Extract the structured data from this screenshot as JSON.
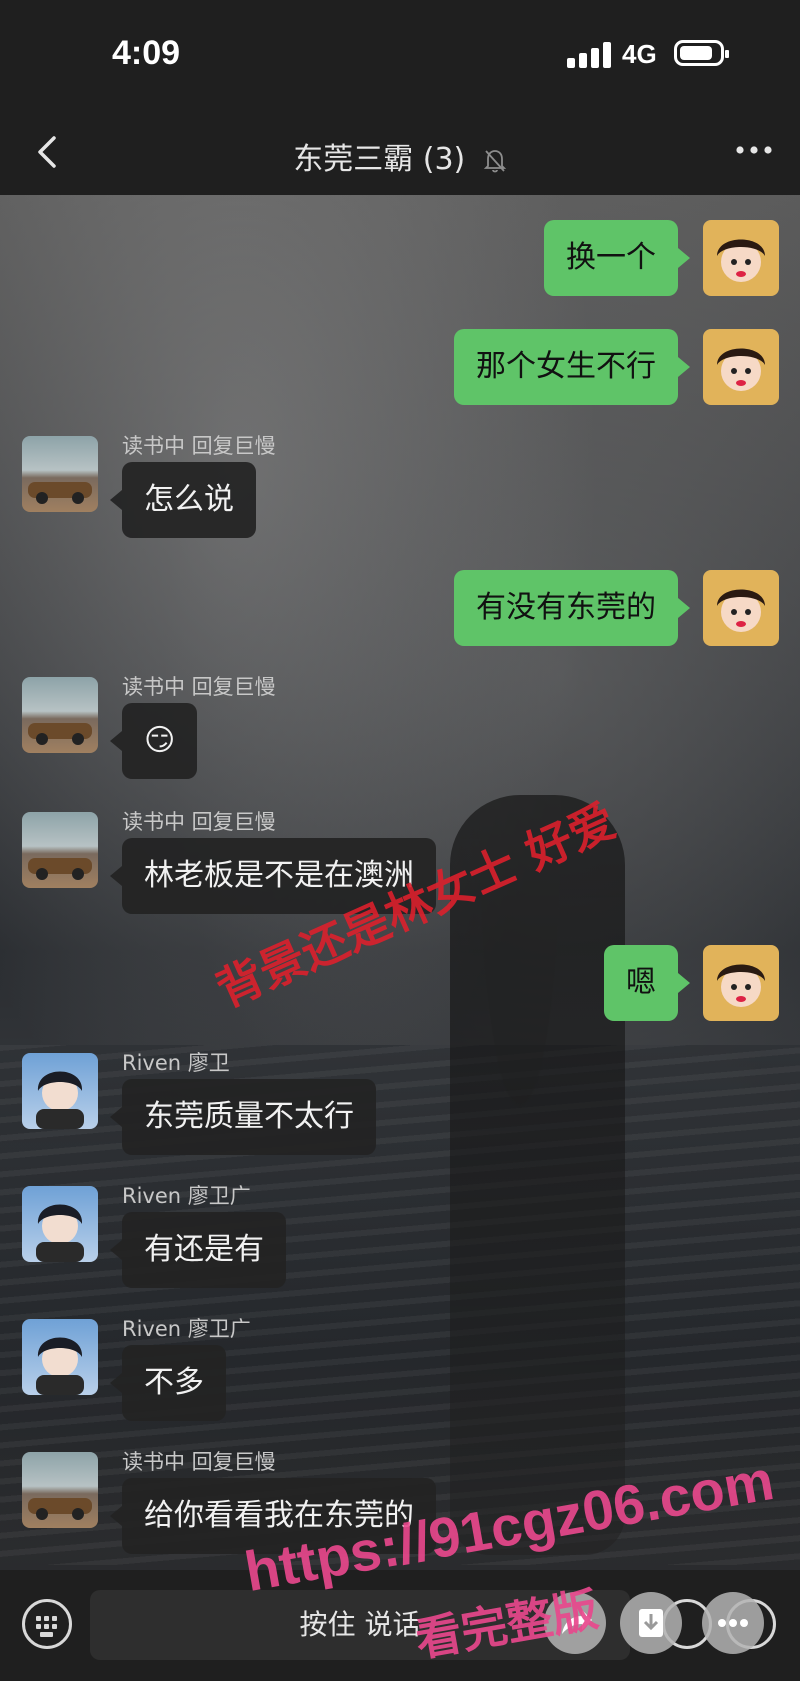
{
  "status_bar": {
    "time": "4:09",
    "network": "4G"
  },
  "nav": {
    "title": "东莞三霸 (3)"
  },
  "messages": [
    {
      "side": "me",
      "text": "换一个"
    },
    {
      "side": "me",
      "text": "那个女生不行"
    },
    {
      "side": "them",
      "sender": "读书中 回复巨慢",
      "text": "怎么说"
    },
    {
      "side": "me",
      "text": "有没有东莞的"
    },
    {
      "side": "them",
      "sender": "读书中 回复巨慢",
      "text": "😏"
    },
    {
      "side": "them",
      "sender": "读书中 回复巨慢",
      "text": "林老板是不是在澳洲"
    },
    {
      "side": "me",
      "text": "嗯"
    },
    {
      "side": "them",
      "sender": "Riven 廖卫",
      "text": "东莞质量不太行"
    },
    {
      "side": "them",
      "sender": "Riven 廖卫广",
      "text": "有还是有"
    },
    {
      "side": "them",
      "sender": "Riven 廖卫广",
      "text": "不多"
    },
    {
      "side": "them",
      "sender": "读书中 回复巨慢",
      "text": "给你看看我在东莞的"
    }
  ],
  "input_bar": {
    "hold_to_talk": "按住 说话"
  },
  "watermark": {
    "line1": "背景还是林女士 好爱",
    "url": "https://91cgz06.com",
    "line3": "看完整版"
  },
  "colors": {
    "bubble_me": "#5fc468",
    "bubble_them": "#232323",
    "watermark_red": "#dc202c",
    "watermark_pink": "#e7488c"
  }
}
